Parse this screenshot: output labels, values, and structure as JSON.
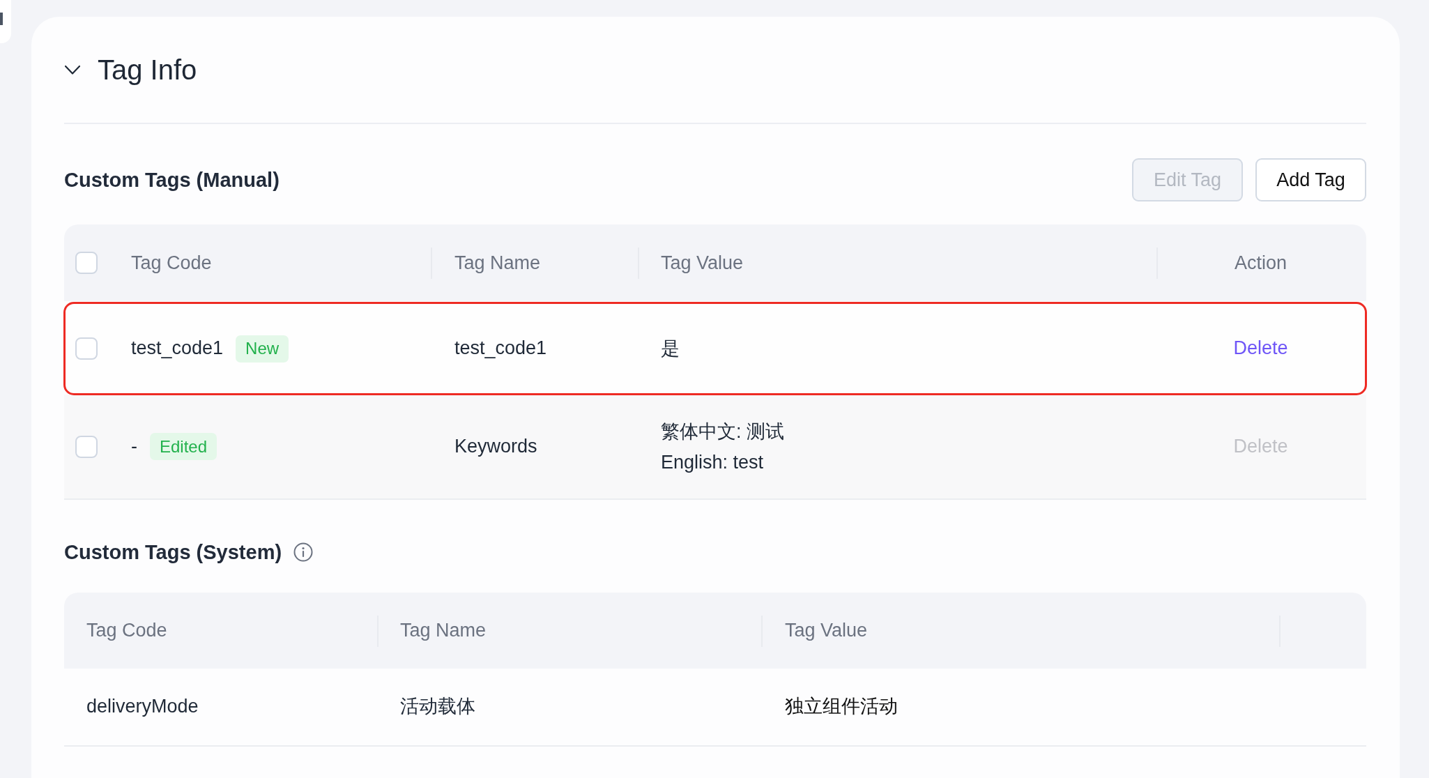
{
  "section": {
    "title": "Tag Info",
    "expanded": true
  },
  "manual_tags": {
    "title": "Custom Tags (Manual)",
    "buttons": [
      {
        "label": "Edit Tag",
        "disabled": true
      },
      {
        "label": "Add Tag",
        "disabled": false
      }
    ],
    "table": {
      "select_all_checked": false,
      "columns": [
        "Tag Code",
        "Tag Name",
        "Tag Value",
        "Action"
      ],
      "rows": [
        {
          "checked": false,
          "highlighted": true,
          "disabled": false,
          "tag_code": "test_code1",
          "badge": "New",
          "tag_name": "test_code1",
          "tag_value": [
            "是"
          ],
          "action": "Delete"
        },
        {
          "checked": false,
          "highlighted": false,
          "disabled": true,
          "tag_code": "-",
          "badge": "Edited",
          "tag_name": "Keywords",
          "tag_value": [
            "繁体中文: 测试",
            "English: test"
          ],
          "action": "Delete"
        }
      ]
    }
  },
  "system_tags": {
    "title": "Custom Tags (System)",
    "table": {
      "columns": [
        "Tag Code",
        "Tag Name",
        "Tag Value"
      ],
      "rows": [
        {
          "cells": [
            "deliveryMode",
            "活动载体",
            "独立组件活动"
          ]
        }
      ]
    }
  }
}
